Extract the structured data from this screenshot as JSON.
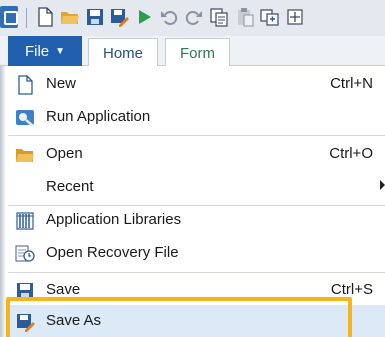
{
  "toolbar": {
    "buttons": [
      {
        "name": "new",
        "icon": "document-icon"
      },
      {
        "name": "open",
        "icon": "folder-icon"
      },
      {
        "name": "save",
        "icon": "floppy-icon"
      },
      {
        "name": "save-as",
        "icon": "save-as-icon"
      },
      {
        "name": "run",
        "icon": "play-icon"
      },
      {
        "name": "undo",
        "icon": "undo-icon"
      },
      {
        "name": "redo",
        "icon": "redo-icon"
      },
      {
        "name": "copy",
        "icon": "copy-icon"
      },
      {
        "name": "paste",
        "icon": "paste-icon"
      },
      {
        "name": "duplicate",
        "icon": "duplicate-icon"
      },
      {
        "name": "more",
        "icon": "more-icon"
      }
    ]
  },
  "ribbon": {
    "file_label": "File",
    "file_caret": "▼",
    "tabs": [
      "Home",
      "Form"
    ]
  },
  "menu": {
    "items": [
      {
        "label": "New",
        "shortcut": "Ctrl+N",
        "icon": "new-document-icon"
      },
      {
        "label": "Run Application",
        "shortcut": "",
        "icon": "run-application-icon"
      },
      {
        "label": "Open",
        "shortcut": "Ctrl+O",
        "icon": "folder-open-icon"
      },
      {
        "label": "Recent",
        "shortcut": "",
        "icon": "",
        "submenu": true
      },
      {
        "label": "Application Libraries",
        "shortcut": "",
        "icon": "libraries-icon"
      },
      {
        "label": "Open Recovery File",
        "shortcut": "",
        "icon": "recovery-file-icon"
      },
      {
        "label": "Save",
        "shortcut": "Ctrl+S",
        "icon": "save-icon"
      },
      {
        "label": "Save As",
        "shortcut": "",
        "icon": "save-as-icon",
        "highlighted": true
      }
    ]
  },
  "colors": {
    "file_tab": "#1f5fae",
    "highlight": "#f7b51b",
    "hover": "#dce9f7"
  }
}
